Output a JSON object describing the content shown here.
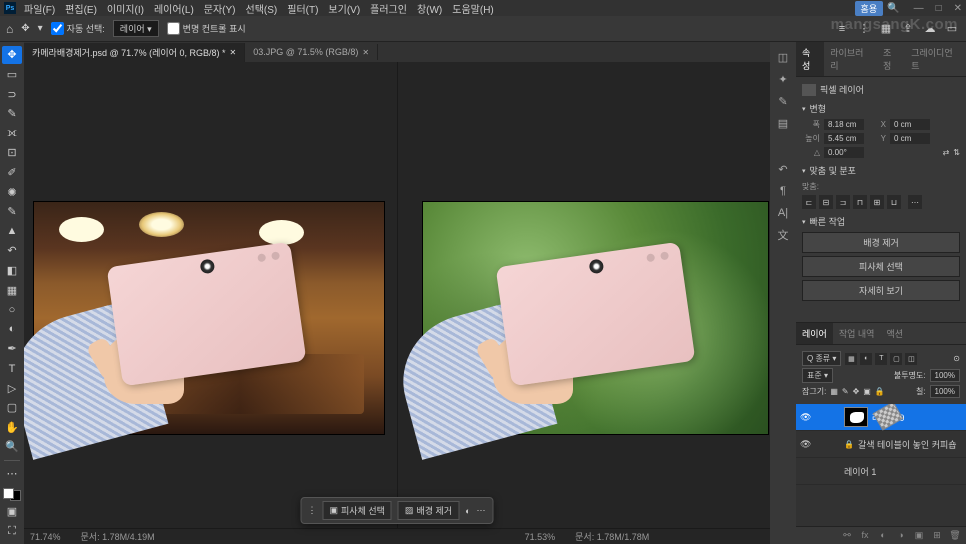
{
  "watermark": "mangsangK.com",
  "titlebar": {
    "menu": [
      "파일(F)",
      "편집(E)",
      "이미지(I)",
      "레이어(L)",
      "문자(Y)",
      "선택(S)",
      "필터(T)",
      "보기(V)",
      "플러그인",
      "창(W)",
      "도움말(H)"
    ],
    "home": "홈용",
    "winctrl": [
      "—",
      "□",
      "✕"
    ]
  },
  "optbar": {
    "auto_sel": "자동 선택:",
    "target": "레이어",
    "show_transform": "변명 컨트롤 표시"
  },
  "tabs": [
    {
      "label": "카메라배경제거.psd @ 71.7% (레이어 0, RGB/8) *"
    },
    {
      "label": "03.JPG @ 71.5% (RGB/8)"
    }
  ],
  "ctxbar": {
    "subject": "피사체 선택",
    "removebg": "배경 제거"
  },
  "status": {
    "left": "71.74%",
    "left_info": "문서: 1.78M/4.19M",
    "right": "71.53%",
    "right_info": "문서: 1.78M/1.78M"
  },
  "props": {
    "tabs": [
      "속성",
      "라이브러리",
      "조정",
      "그레이디언트"
    ],
    "header": "픽셀 레이어",
    "transform_title": "변형",
    "w_lbl": "폭",
    "w_val": "8.18 cm",
    "x_lbl": "X",
    "x_val": "0 cm",
    "h_lbl": "높이",
    "h_val": "5.45 cm",
    "y_lbl": "Y",
    "y_val": "0 cm",
    "angle_lbl": "△",
    "angle_val": "0.00°",
    "align_title": "맞춤 및 분포",
    "align_lbl": "맞춤:",
    "actions_title": "빠른 작업",
    "a1": "배경 제거",
    "a2": "피사체 선택",
    "a3": "자세히 보기"
  },
  "layers": {
    "tabs": [
      "레이어",
      "작업 내역",
      "액션"
    ],
    "kind": "Q 종류",
    "blend_lbl": "표준",
    "opacity_lbl": "불투명도:",
    "opacity_val": "100%",
    "lock_lbl": "잠그기:",
    "fill_lbl": "칠:",
    "fill_val": "100%",
    "items": [
      {
        "name": "레이어 0",
        "visible": true,
        "selected": true,
        "mask": true
      },
      {
        "name": "갈색 테이블이 놓인 커피숍",
        "visible": true,
        "selected": false,
        "mask": false,
        "lock": true
      },
      {
        "name": "레이어 1",
        "visible": false,
        "selected": false,
        "mask": false,
        "checker": true
      }
    ]
  }
}
